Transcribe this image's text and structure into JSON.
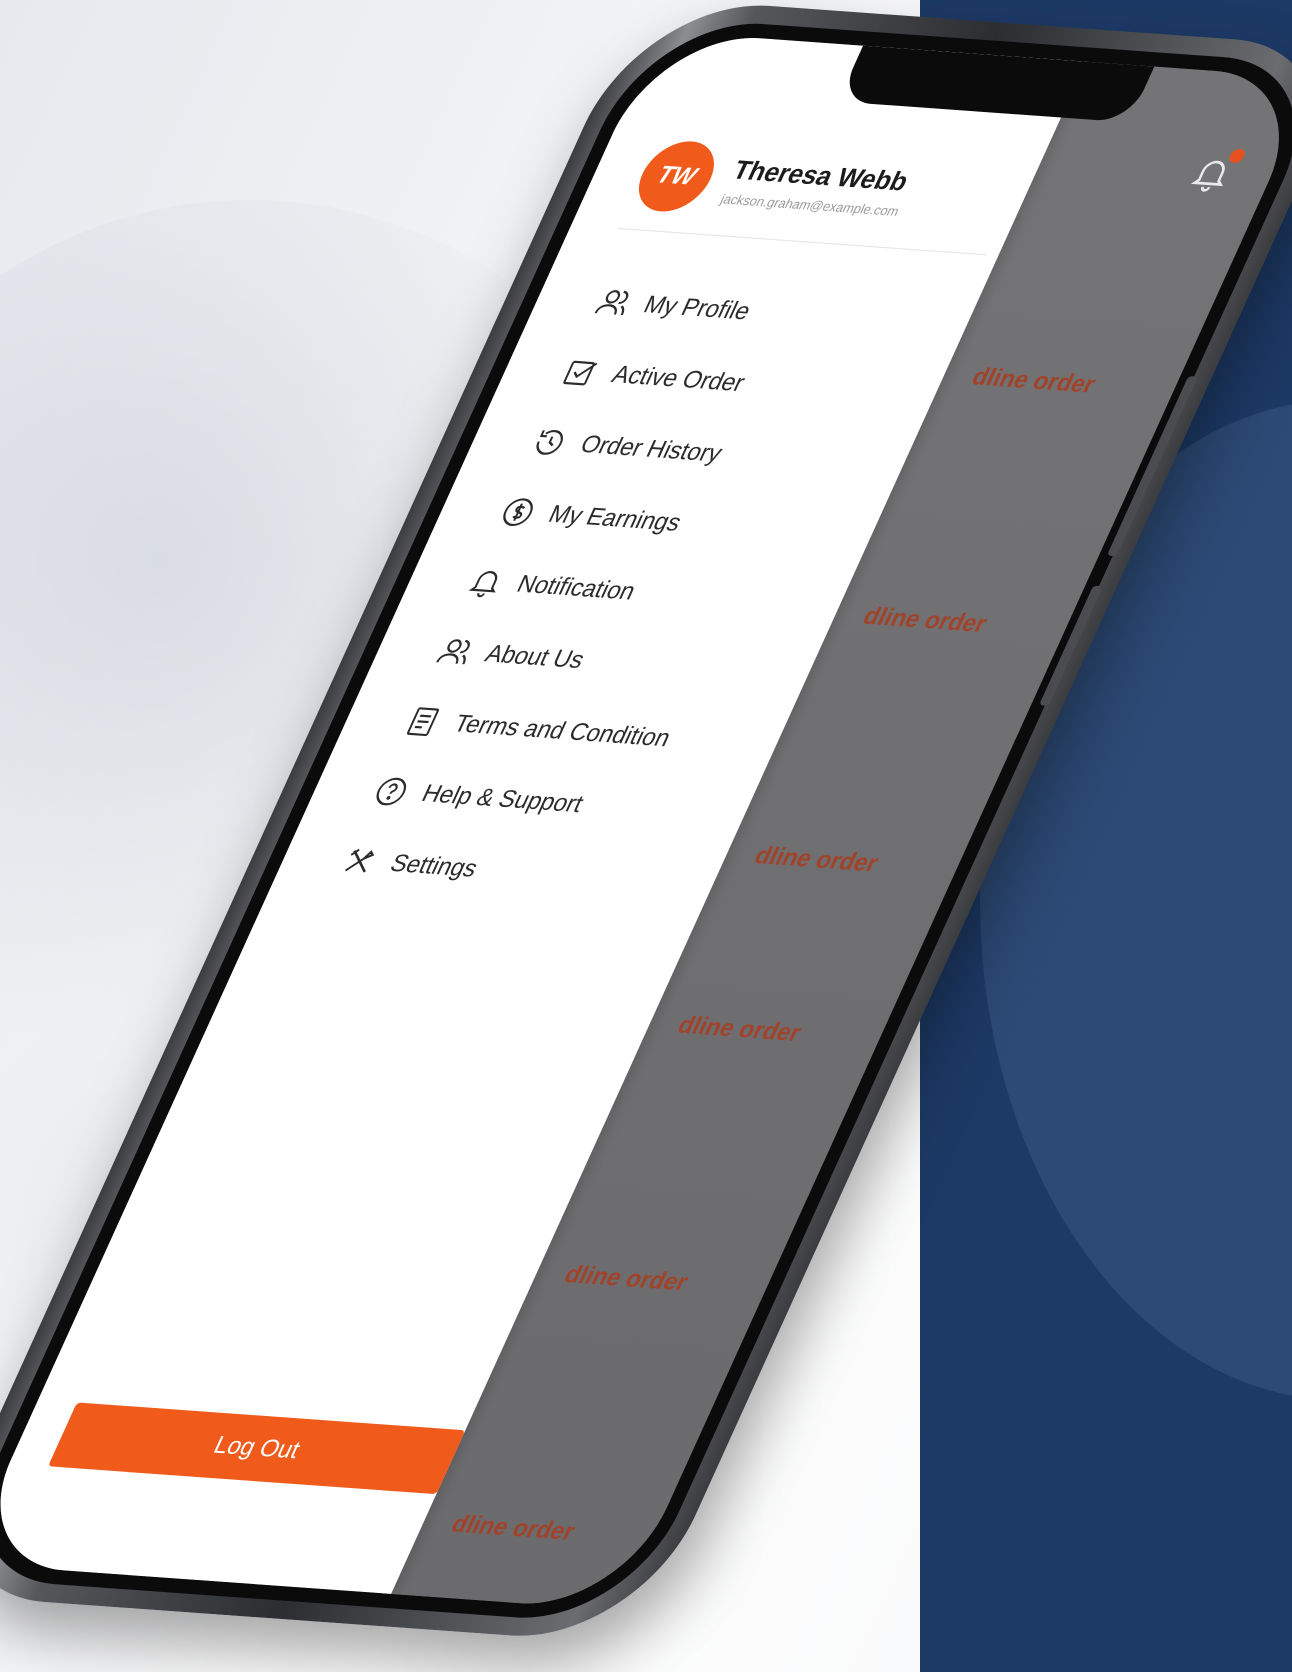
{
  "user": {
    "initials": "TW",
    "name": "Theresa Webb",
    "email": "jackson.graham@example.com"
  },
  "menu": [
    {
      "label": "My Profile",
      "icon": "profile-icon"
    },
    {
      "label": "Active Order",
      "icon": "active-order-icon"
    },
    {
      "label": "Order History",
      "icon": "order-history-icon"
    },
    {
      "label": "My Earnings",
      "icon": "earnings-icon"
    },
    {
      "label": "Notification",
      "icon": "bell-icon"
    },
    {
      "label": "About Us",
      "icon": "about-us-icon"
    },
    {
      "label": "Terms and Condition",
      "icon": "document-icon"
    },
    {
      "label": "Help & Support",
      "icon": "help-icon"
    },
    {
      "label": "Settings",
      "icon": "settings-icon"
    }
  ],
  "logout_label": "Log Out",
  "background_screen": {
    "order_labels": [
      "dline order",
      "dline order",
      "dline order",
      "dline order",
      "dline order",
      "dline order"
    ]
  },
  "colors": {
    "accent": "#f05a1a",
    "navy": "#1d3a66",
    "order_text": "#a0432a"
  }
}
